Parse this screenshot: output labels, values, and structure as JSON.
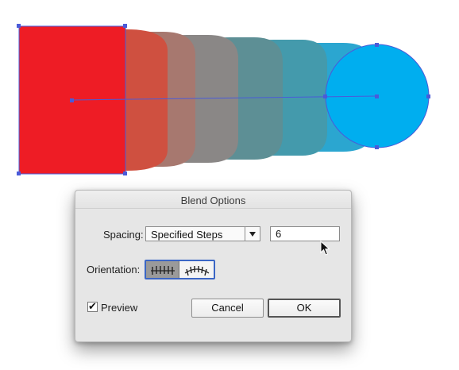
{
  "colors": {
    "start_shape": "#ee1c25",
    "end_shape": "#00aeef",
    "selection": "#4a5bd9"
  },
  "dialog": {
    "title": "Blend Options",
    "spacing_label": "Spacing:",
    "spacing_value": "Specified Steps",
    "steps_value": "6",
    "orientation_label": "Orientation:",
    "orientation_options": [
      "align-to-page-icon",
      "align-to-path-icon"
    ],
    "orientation_selected": "align-to-page",
    "preview_label": "Preview",
    "preview_checked": true,
    "cancel_label": "Cancel",
    "ok_label": "OK"
  }
}
